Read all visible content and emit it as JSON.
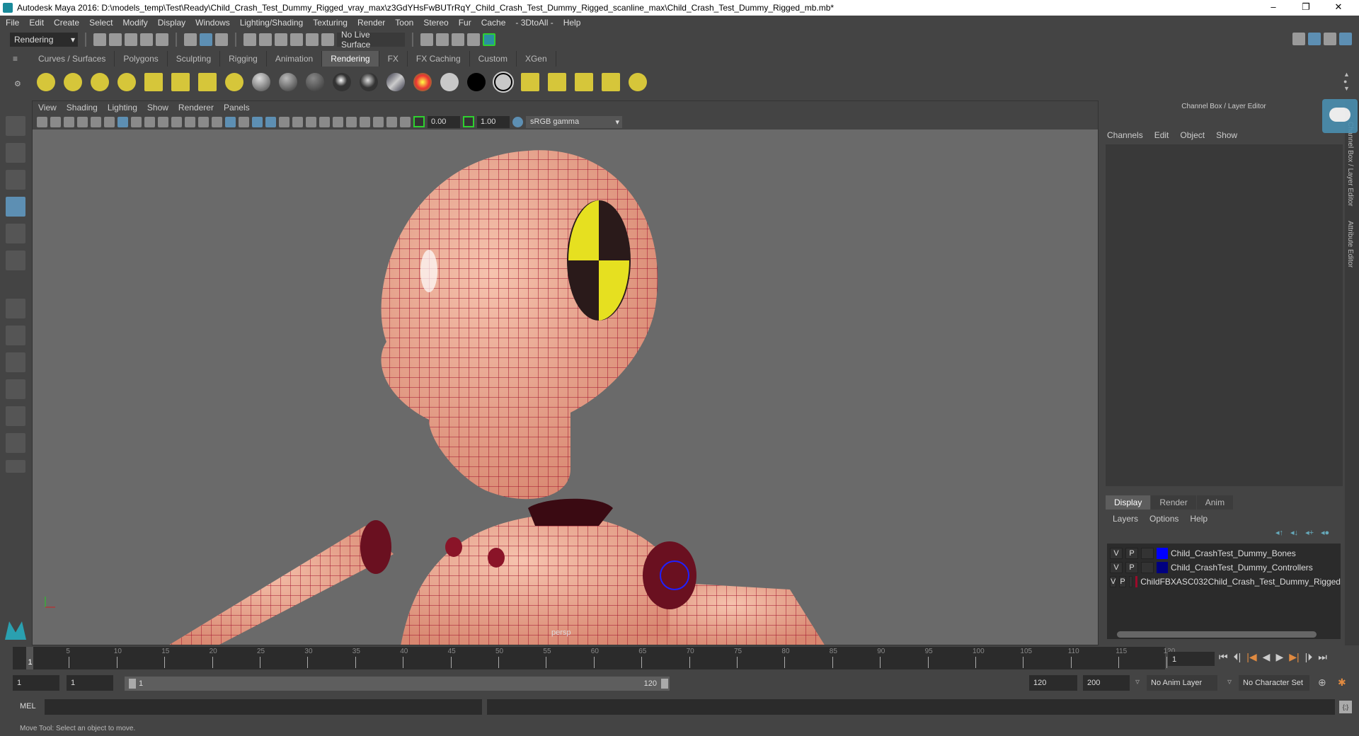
{
  "window": {
    "title": "Autodesk Maya 2016: D:\\models_temp\\Test\\Ready\\Child_Crash_Test_Dummy_Rigged_vray_max\\z3GdYHsFwBUTrRqY_Child_Crash_Test_Dummy_Rigged_scanline_max\\Child_Crash_Test_Dummy_Rigged_mb.mb*",
    "minimize": "–",
    "restore": "❐",
    "close": "✕"
  },
  "menu": [
    "File",
    "Edit",
    "Create",
    "Select",
    "Modify",
    "Display",
    "Windows",
    "Lighting/Shading",
    "Texturing",
    "Render",
    "Toon",
    "Stereo",
    "Fur",
    "Cache",
    "- 3DtoAll -",
    "Help"
  ],
  "statusline": {
    "mode": "Rendering",
    "live_surface": "No Live Surface"
  },
  "shelf_tabs": [
    "Curves / Surfaces",
    "Polygons",
    "Sculpting",
    "Rigging",
    "Animation",
    "Rendering",
    "FX",
    "FX Caching",
    "Custom",
    "XGen"
  ],
  "active_shelf": "Rendering",
  "viewport": {
    "menu": [
      "View",
      "Shading",
      "Lighting",
      "Show",
      "Renderer",
      "Panels"
    ],
    "exposure": "0.00",
    "gamma": "1.00",
    "color_space": "sRGB gamma",
    "camera": "persp"
  },
  "channel_box": {
    "title": "Channel Box / Layer Editor",
    "menu": [
      "Channels",
      "Edit",
      "Object",
      "Show"
    ]
  },
  "layer_editor": {
    "tabs": [
      "Display",
      "Render",
      "Anim"
    ],
    "menu": [
      "Layers",
      "Options",
      "Help"
    ],
    "layers": [
      {
        "v": "V",
        "p": "P",
        "color": "#0000ff",
        "name": "Child_CrashTest_Dummy_Bones"
      },
      {
        "v": "V",
        "p": "P",
        "color": "#000080",
        "name": "Child_CrashTest_Dummy_Controllers"
      },
      {
        "v": "V",
        "p": "P",
        "color": "#9b0a2a",
        "name": "ChildFBXASC032Child_Crash_Test_Dummy_Rigged"
      }
    ]
  },
  "side_tabs": [
    "Channel Box / Layer Editor",
    "Attribute Editor"
  ],
  "timeline": {
    "start": 1,
    "end": 120,
    "labels": [
      5,
      10,
      15,
      20,
      25,
      30,
      35,
      40,
      45,
      50,
      55,
      60,
      65,
      70,
      75,
      80,
      85,
      90,
      95,
      100,
      105,
      110,
      115,
      120
    ],
    "current": "1",
    "current_frame_field": "1"
  },
  "range": {
    "start": "1",
    "playback_start": "1",
    "slider_start": "1",
    "slider_end": "120",
    "playback_end": "120",
    "end": "200",
    "anim_layer": "No Anim Layer",
    "character_set": "No Character Set"
  },
  "mel": {
    "label": "MEL"
  },
  "status": "Move Tool: Select an object to move.",
  "colors": {
    "skin": "#e9a48f",
    "wire": "#a0102c",
    "accent": "#5d8fb3"
  }
}
